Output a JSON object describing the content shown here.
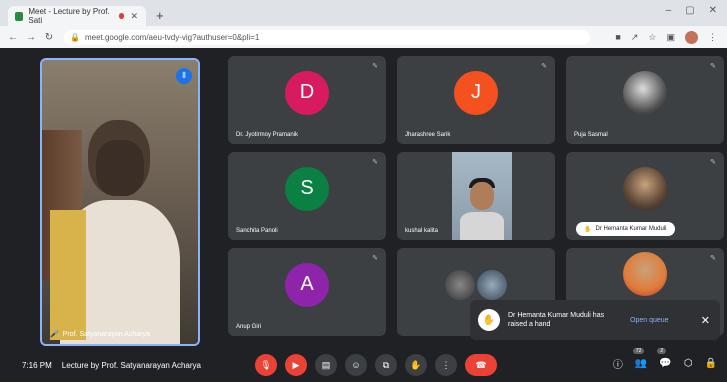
{
  "browser": {
    "tab_title": "Meet - Lecture by Prof. Sati",
    "url": "meet.google.com/aeu-tvdy-vig?authuser=0&pli=1",
    "new_tab_icon": "plus-icon"
  },
  "meeting": {
    "self_view_name": "Prof. Satyanarayan Acharya",
    "time": "7:16 PM",
    "title": "Lecture by Prof. Satyanarayan Acharya",
    "open_queue_label": "Open queue"
  },
  "participants": [
    {
      "name": "Dr. Jyotirmoy Pramanik",
      "initial": "D",
      "color": "#d81b60"
    },
    {
      "name": "Jharashree Sarik",
      "initial": "J",
      "color": "#f4511e"
    },
    {
      "name": "Puja Sasmal",
      "initial": "",
      "color": "#ffffff"
    },
    {
      "name": "Sanchita Panoli",
      "initial": "S",
      "color": "#0b8043"
    },
    {
      "name": "kushal kalita",
      "initial": "",
      "color": "#a7b8c6"
    },
    {
      "name": "Dr Hemanta Kumar Muduli",
      "initial": "",
      "color": "#c9a27a"
    },
    {
      "name": "Anup Giri",
      "initial": "A",
      "color": "#8e24aa"
    },
    {
      "name": "",
      "initial": "",
      "color": "#555"
    },
    {
      "name": "",
      "initial": "",
      "color": "#c9a27a"
    }
  ],
  "toast": {
    "message": "Dr Hemanta Kumar Muduli has raised a hand"
  },
  "controls": {
    "participant_count": "72",
    "chat_count": "2"
  }
}
